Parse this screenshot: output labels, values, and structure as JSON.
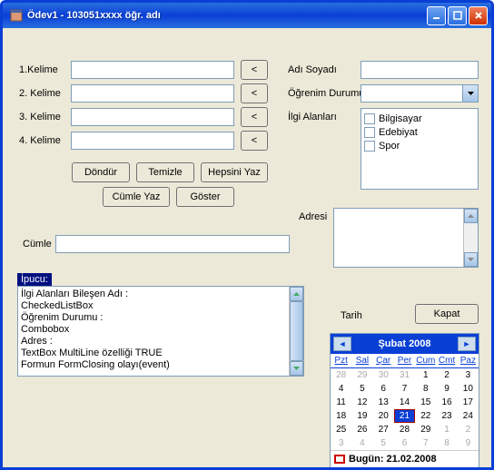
{
  "window": {
    "title": "Ödev1 - 103051xxxx öğr. adı"
  },
  "labels": {
    "k1": "1.Kelime",
    "k2": "2. Kelime",
    "k3": "3. Kelime",
    "k4": "4. Kelime",
    "cumle": "Cümle",
    "adsoyad": "Adı Soyadı",
    "ogrenim": "Öğrenim Durumu",
    "ilgi": "İlgi Alanları",
    "adresi": "Adresi",
    "tarih": "Tarih",
    "ipucu": "İpucu:"
  },
  "buttons": {
    "lt": "<",
    "dondur": "Döndür",
    "temizle": "Temizle",
    "hepsiniyaz": "Hepsini Yaz",
    "cumleyaz": "Cümle Yaz",
    "goster": "Göster",
    "kapat": "Kapat"
  },
  "ilgi_items": [
    "Bilgisayar",
    "Edebiyat",
    "Spor"
  ],
  "ipucu_lines": [
    "İlgi Alanları Bileşen Adı :",
    "CheckedListBox",
    "Öğrenim Durumu :",
    "Combobox",
    "Adres :",
    "TextBox MultiLine özelliği  TRUE",
    "Formun FormClosing olayı(event)"
  ],
  "calendar": {
    "header": "Şubat 2008",
    "dow": [
      "Pzt",
      "Sal",
      "Çar",
      "Per",
      "Cum",
      "Cmt",
      "Paz"
    ],
    "today_label": "Bugün: 21.02.2008",
    "rows": [
      [
        {
          "d": "28",
          "o": 1
        },
        {
          "d": "29",
          "o": 1
        },
        {
          "d": "30",
          "o": 1
        },
        {
          "d": "31",
          "o": 1
        },
        {
          "d": "1"
        },
        {
          "d": "2"
        },
        {
          "d": "3"
        }
      ],
      [
        {
          "d": "4"
        },
        {
          "d": "5"
        },
        {
          "d": "6"
        },
        {
          "d": "7"
        },
        {
          "d": "8"
        },
        {
          "d": "9"
        },
        {
          "d": "10"
        }
      ],
      [
        {
          "d": "11"
        },
        {
          "d": "12"
        },
        {
          "d": "13"
        },
        {
          "d": "14"
        },
        {
          "d": "15"
        },
        {
          "d": "16"
        },
        {
          "d": "17"
        }
      ],
      [
        {
          "d": "18"
        },
        {
          "d": "19"
        },
        {
          "d": "20"
        },
        {
          "d": "21",
          "sel": 1
        },
        {
          "d": "22"
        },
        {
          "d": "23"
        },
        {
          "d": "24"
        }
      ],
      [
        {
          "d": "25"
        },
        {
          "d": "26"
        },
        {
          "d": "27"
        },
        {
          "d": "28"
        },
        {
          "d": "29"
        },
        {
          "d": "1",
          "o": 1
        },
        {
          "d": "2",
          "o": 1
        }
      ],
      [
        {
          "d": "3",
          "o": 1
        },
        {
          "d": "4",
          "o": 1
        },
        {
          "d": "5",
          "o": 1
        },
        {
          "d": "6",
          "o": 1
        },
        {
          "d": "7",
          "o": 1
        },
        {
          "d": "8",
          "o": 1
        },
        {
          "d": "9",
          "o": 1
        }
      ]
    ]
  }
}
